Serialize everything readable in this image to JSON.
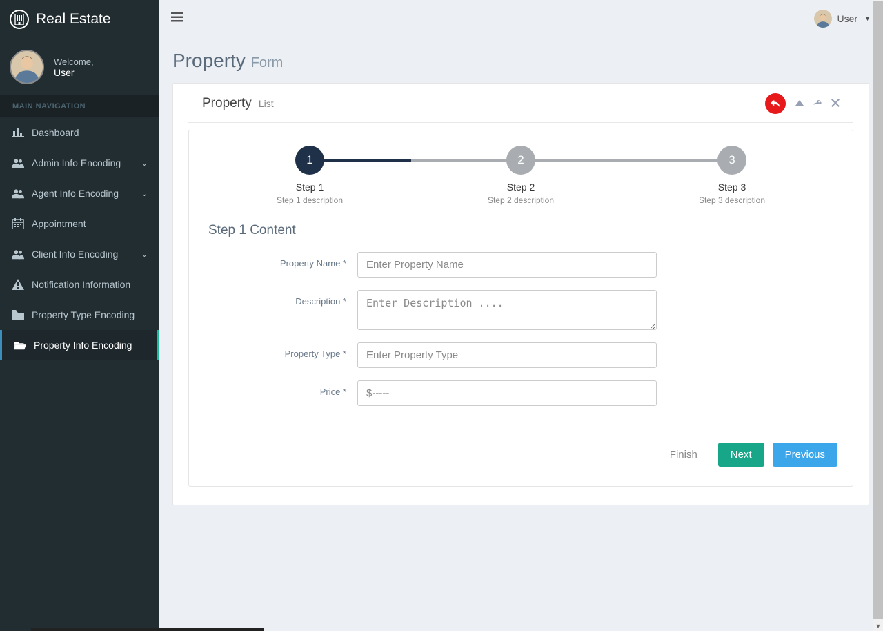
{
  "brand": "Real Estate",
  "user_panel": {
    "welcome": "Welcome,",
    "name": "User"
  },
  "nav_header": "MAIN NAVIGATION",
  "sidebar": {
    "items": [
      {
        "label": "Dashboard",
        "icon": "chart-icon",
        "expandable": false
      },
      {
        "label": "Admin Info Encoding",
        "icon": "users-icon",
        "expandable": true
      },
      {
        "label": "Agent Info Encoding",
        "icon": "users-icon",
        "expandable": true
      },
      {
        "label": "Appointment",
        "icon": "calendar-icon",
        "expandable": false
      },
      {
        "label": "Client Info Encoding",
        "icon": "users-icon",
        "expandable": true
      },
      {
        "label": "Notification Information",
        "icon": "warning-icon",
        "expandable": false
      },
      {
        "label": "Property Type Encoding",
        "icon": "folder-icon",
        "expandable": false
      },
      {
        "label": "Property Info Encoding",
        "icon": "folder-open-icon",
        "expandable": false,
        "active": true
      }
    ]
  },
  "topbar": {
    "user_label": "User"
  },
  "page": {
    "title": "Property",
    "subtitle": "Form"
  },
  "panel": {
    "title": "Property",
    "subtitle": "List"
  },
  "wizard": {
    "steps": [
      {
        "num": "1",
        "label": "Step 1",
        "desc": "Step 1 description"
      },
      {
        "num": "2",
        "label": "Step 2",
        "desc": "Step 2 description"
      },
      {
        "num": "3",
        "label": "Step 3",
        "desc": "Step 3 description"
      }
    ],
    "heading": "Step 1 Content",
    "fields": {
      "name": {
        "label": "Property Name *",
        "placeholder": "Enter Property Name"
      },
      "description": {
        "label": "Description *",
        "placeholder": "Enter Description ...."
      },
      "type": {
        "label": "Property Type *",
        "placeholder": "Enter Property Type"
      },
      "price": {
        "label": "Price *",
        "placeholder": "$-----"
      }
    },
    "buttons": {
      "finish": "Finish",
      "next": "Next",
      "previous": "Previous"
    }
  }
}
